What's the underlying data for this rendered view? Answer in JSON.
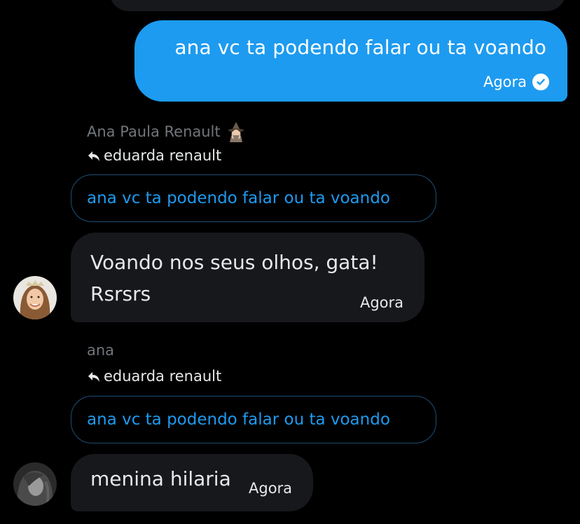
{
  "conversation": {
    "sent_message": {
      "text": "ana vc ta podendo falar ou ta voando",
      "time": "Agora",
      "status_icon": "check-circle-icon"
    },
    "replies": [
      {
        "sender_name": "Ana Paula Renault",
        "sender_emoji": "witch-emoji-icon",
        "reply_to_name": "eduarda renault",
        "quoted_text": "ana vc ta podendo falar ou ta voando",
        "message_line1": "Voando nos seus olhos, gata!",
        "message_line2": "Rsrsrs",
        "time": "Agora"
      },
      {
        "sender_name": "ana",
        "reply_to_name": "eduarda renault",
        "quoted_text": "ana vc ta podendo falar ou ta voando",
        "message": "menina hilaria",
        "time": "Agora"
      }
    ]
  },
  "colors": {
    "background": "#000000",
    "sent_bubble": "#1d9bf0",
    "received_bubble": "#16181c",
    "muted_text": "#71767b",
    "link_blue": "#1d9bf0",
    "quote_border": "#1d4e75"
  }
}
